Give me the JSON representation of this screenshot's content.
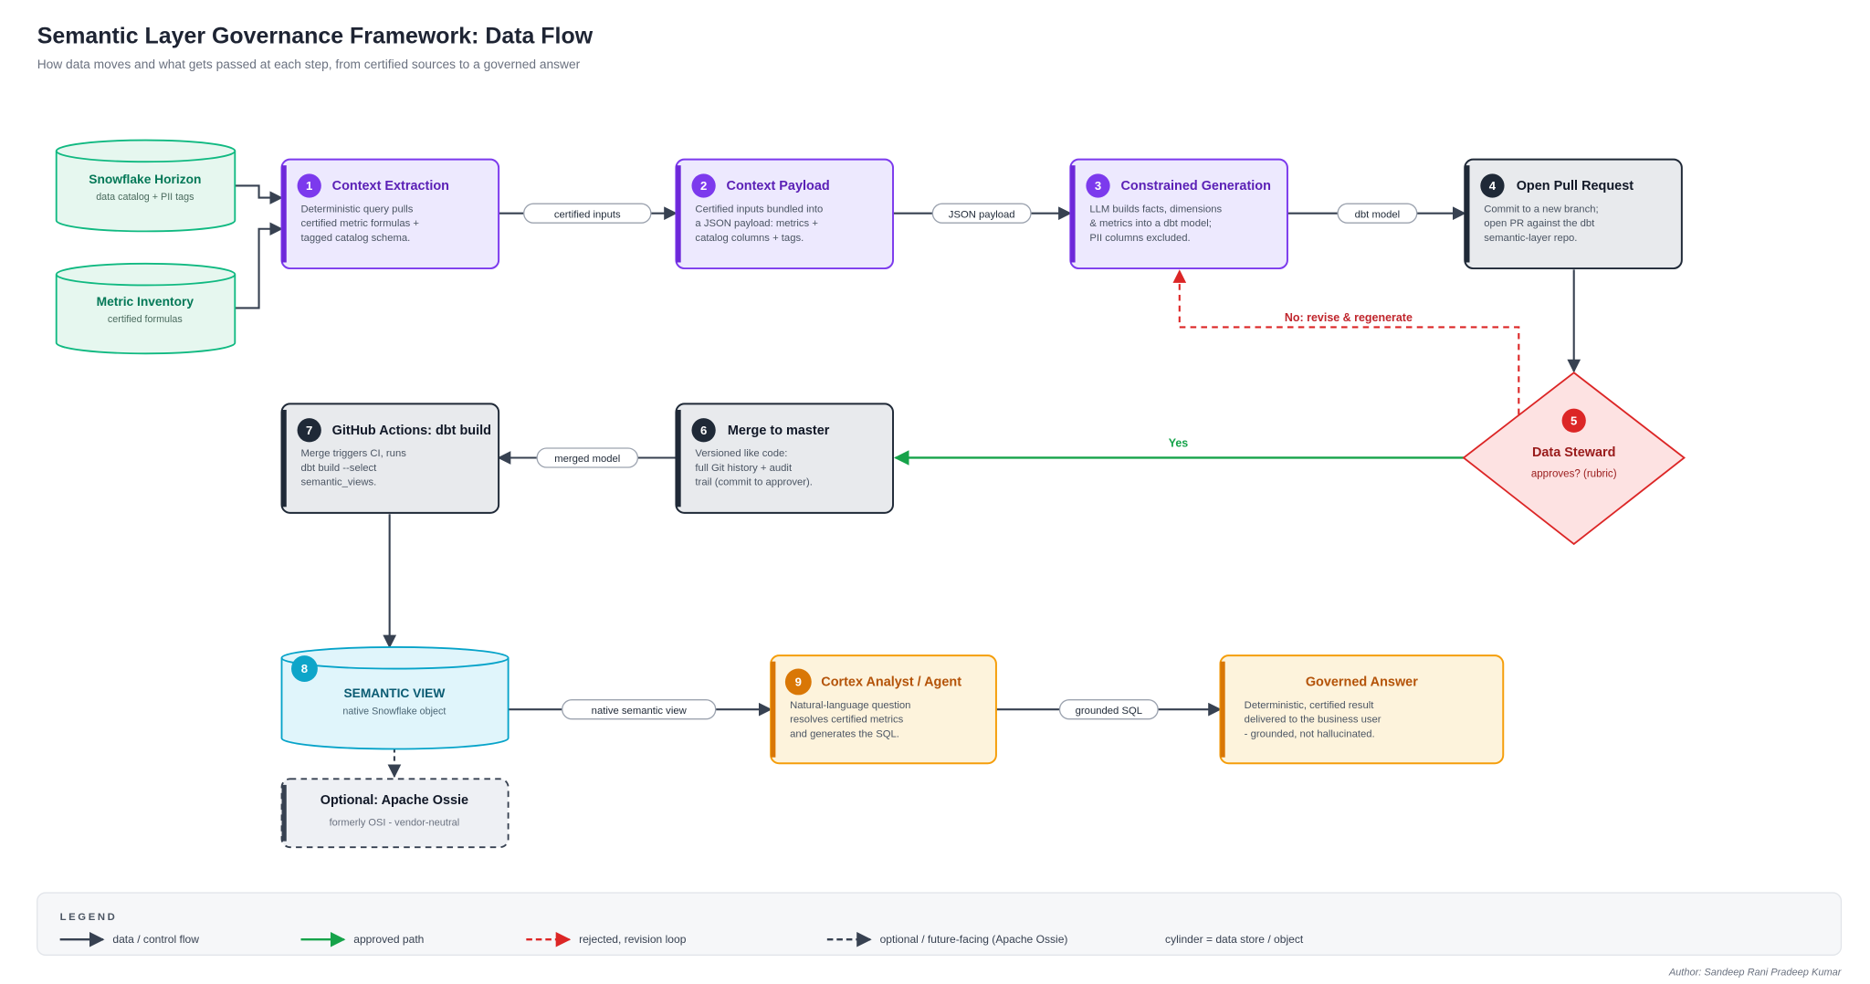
{
  "title": "Semantic Layer Governance Framework: Data Flow",
  "subtitle": "How data moves and what gets passed at each step, from certified sources to a governed answer",
  "colors": {
    "purple": "#7c3aed",
    "purple_fill": "#ede9fe",
    "dark": "#1f2937",
    "gray_fill": "#e5e7eb",
    "green": "#16a34a",
    "green_db": "#10b981",
    "red": "#dc2626",
    "red_fill": "#fde2e2",
    "cyan": "#06a3c9",
    "cyan_fill": "#e0f5fb",
    "amber": "#d97706",
    "amber_fill": "#fdf3dc"
  },
  "sources": [
    {
      "title": "Snowflake Horizon",
      "sub": "data catalog + PII tags"
    },
    {
      "title": "Metric Inventory",
      "sub": "certified formulas"
    }
  ],
  "steps": {
    "s1": {
      "num": "1",
      "title": "Context Extraction",
      "lines": [
        "Deterministic query pulls",
        "certified metric formulas +",
        "tagged catalog schema."
      ]
    },
    "s2": {
      "num": "2",
      "title": "Context Payload",
      "lines": [
        "Certified inputs bundled into",
        "a JSON payload: metrics +",
        "catalog columns + tags."
      ]
    },
    "s3": {
      "num": "3",
      "title": "Constrained Generation",
      "lines": [
        "LLM builds facts, dimensions",
        "& metrics into a dbt model;",
        "PII columns excluded."
      ]
    },
    "s4": {
      "num": "4",
      "title": "Open Pull Request",
      "lines": [
        "Commit to a new branch;",
        "open PR against the dbt",
        "semantic-layer repo."
      ]
    },
    "s5": {
      "num": "5",
      "title": "Data Steward",
      "sub": "approves? (rubric)"
    },
    "s6": {
      "num": "6",
      "title": "Merge to master",
      "lines": [
        "Versioned like code:",
        "full Git history + audit",
        "trail (commit to approver)."
      ]
    },
    "s7": {
      "num": "7",
      "title": "GitHub Actions: dbt build",
      "lines": [
        "Merge triggers CI, runs",
        "dbt build --select",
        "semantic_views."
      ]
    },
    "s8": {
      "num": "8",
      "title": "SEMANTIC VIEW",
      "sub": "native Snowflake object"
    },
    "s9": {
      "num": "9",
      "title": "Cortex Analyst / Agent",
      "lines": [
        "Natural-language question",
        "resolves certified metrics",
        "and generates the SQL."
      ]
    },
    "answer": {
      "title": "Governed Answer",
      "lines": [
        "Deterministic, certified result",
        "delivered to the business user",
        "- grounded, not hallucinated."
      ]
    },
    "optional": {
      "title": "Optional: Apache Ossie",
      "sub": "formerly OSI - vendor-neutral"
    }
  },
  "edge_labels": {
    "e1": "certified inputs",
    "e2": "JSON payload",
    "e3": "dbt model",
    "yes": "Yes",
    "no": "No: revise & regenerate",
    "e6": "merged model",
    "e8": "native semantic view",
    "e9": "grounded SQL"
  },
  "legend": {
    "title": "LEGEND",
    "items": [
      {
        "label": "data / control flow",
        "style": "solid-dark"
      },
      {
        "label": "approved path",
        "style": "solid-green"
      },
      {
        "label": "rejected, revision loop",
        "style": "dashed-red"
      },
      {
        "label": "optional / future-facing (Apache Ossie)",
        "style": "dashed-dark"
      },
      {
        "label": "cylinder = data store / object",
        "style": "text"
      }
    ]
  },
  "author": "Author: Sandeep Rani Pradeep Kumar"
}
